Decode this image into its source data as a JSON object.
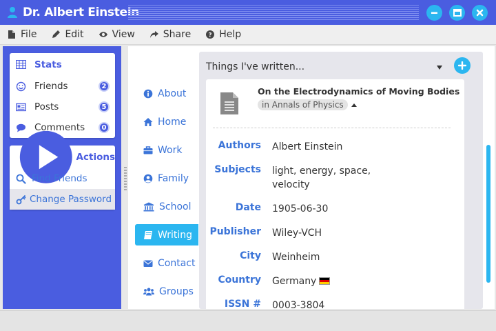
{
  "window": {
    "title": "Dr. Albert Einstein",
    "accent": "#4a5de0",
    "button_color": "#2bb6f0"
  },
  "menu": [
    {
      "label": "File",
      "icon": "file-icon"
    },
    {
      "label": "Edit",
      "icon": "pencil-icon"
    },
    {
      "label": "View",
      "icon": "eye-icon"
    },
    {
      "label": "Share",
      "icon": "share-icon"
    },
    {
      "label": "Help",
      "icon": "help-icon"
    }
  ],
  "stats": {
    "heading": "Stats",
    "items": [
      {
        "label": "Friends",
        "count": "2",
        "icon": "smiley-icon"
      },
      {
        "label": "Posts",
        "count": "5",
        "icon": "newspaper-icon"
      },
      {
        "label": "Comments",
        "count": "0",
        "icon": "comment-icon"
      }
    ]
  },
  "actions": {
    "heading": "Actions",
    "items": [
      {
        "label": "Find Friends",
        "icon": "search-icon"
      },
      {
        "label": "Change Password",
        "icon": "key-icon"
      }
    ]
  },
  "nav": [
    {
      "label": "About",
      "icon": "info-icon"
    },
    {
      "label": "Home",
      "icon": "home-icon"
    },
    {
      "label": "Work",
      "icon": "briefcase-icon"
    },
    {
      "label": "Family",
      "icon": "user-circle-icon"
    },
    {
      "label": "School",
      "icon": "university-icon"
    },
    {
      "label": "Writing",
      "icon": "book-icon",
      "active": true
    },
    {
      "label": "Contact",
      "icon": "envelope-icon"
    },
    {
      "label": "Groups",
      "icon": "users-icon"
    }
  ],
  "content": {
    "heading": "Things I've written...",
    "document": {
      "title": "On the Electrodynamics of Moving Bodies",
      "tag": "in Annals of Physics",
      "fields": [
        {
          "label": "Authors",
          "value": "Albert Einstein"
        },
        {
          "label": "Subjects",
          "value": "light, energy, space, velocity"
        },
        {
          "label": "Date",
          "value": "1905-06-30"
        },
        {
          "label": "Publisher",
          "value": "Wiley-VCH"
        },
        {
          "label": "City",
          "value": "Weinheim"
        },
        {
          "label": "Country",
          "value": "Germany"
        },
        {
          "label": "ISSN #",
          "value": "0003-3804"
        }
      ]
    }
  }
}
